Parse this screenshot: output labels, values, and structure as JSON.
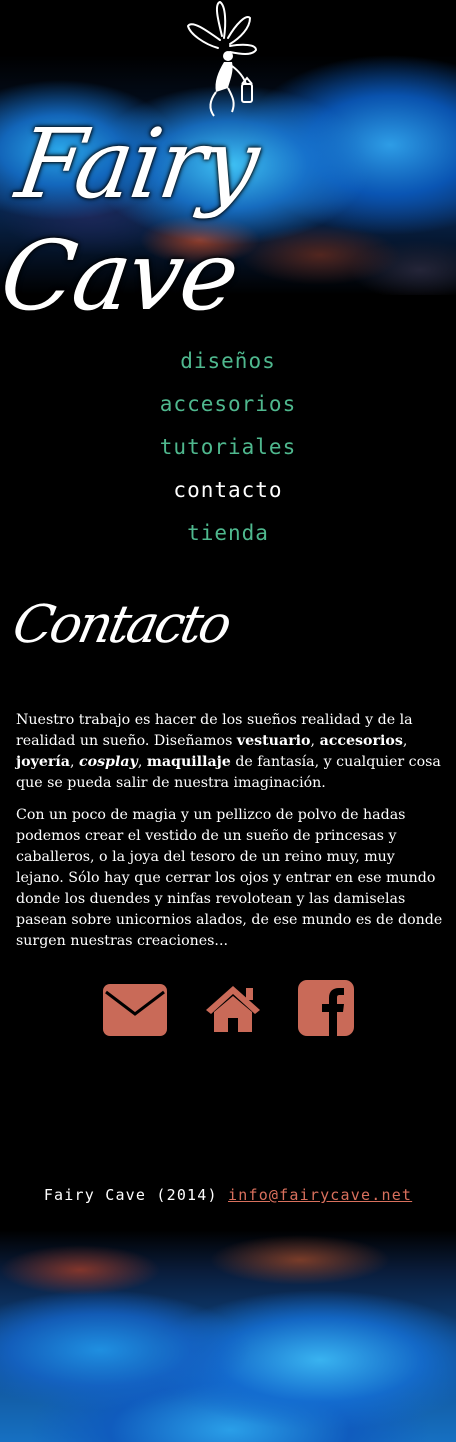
{
  "header": {
    "logo_text": "Fairy Cave"
  },
  "nav": {
    "items": [
      {
        "label": "diseños",
        "active": false
      },
      {
        "label": "accesorios",
        "active": false
      },
      {
        "label": "tutoriales",
        "active": false
      },
      {
        "label": "contacto",
        "active": true
      },
      {
        "label": "tienda",
        "active": false
      }
    ]
  },
  "main": {
    "title": "Contacto",
    "p1": {
      "t1": "Nuestro trabajo es hacer de los sueños realidad y de la realidad un sueño. Diseñamos ",
      "b1": "vestuario",
      "t2": ", ",
      "b2": "accesorios",
      "t3": ", ",
      "b3": "joyería",
      "t4": ", ",
      "b4": "cosplay",
      "t5": ", ",
      "b5": "maquillaje",
      "t6": " de fantasía, y cualquier cosa que se pueda salir de nuestra imaginación."
    },
    "p2": "Con un poco de magia y un pellizco de polvo de hadas podemos crear el vestido de un sueño de princesas y caballeros, o la joya del tesoro de un reino muy, muy lejano. Sólo hay que cerrar los ojos y entrar en ese mundo donde los duendes y ninfas revolotean y las damiselas pasean sobre unicornios alados, de ese mundo es de donde surgen nuestras creaciones..."
  },
  "social": {
    "icons": [
      "envelope-icon",
      "home-icon",
      "facebook-icon"
    ],
    "color": "#c96a58"
  },
  "footer": {
    "copyright": "Fairy Cave (2014)",
    "email": "info@fairycave.net"
  },
  "colors": {
    "nav_link": "#4fb88e",
    "nav_active": "#ffffff",
    "email_link": "#d9705d",
    "background": "#000000"
  }
}
